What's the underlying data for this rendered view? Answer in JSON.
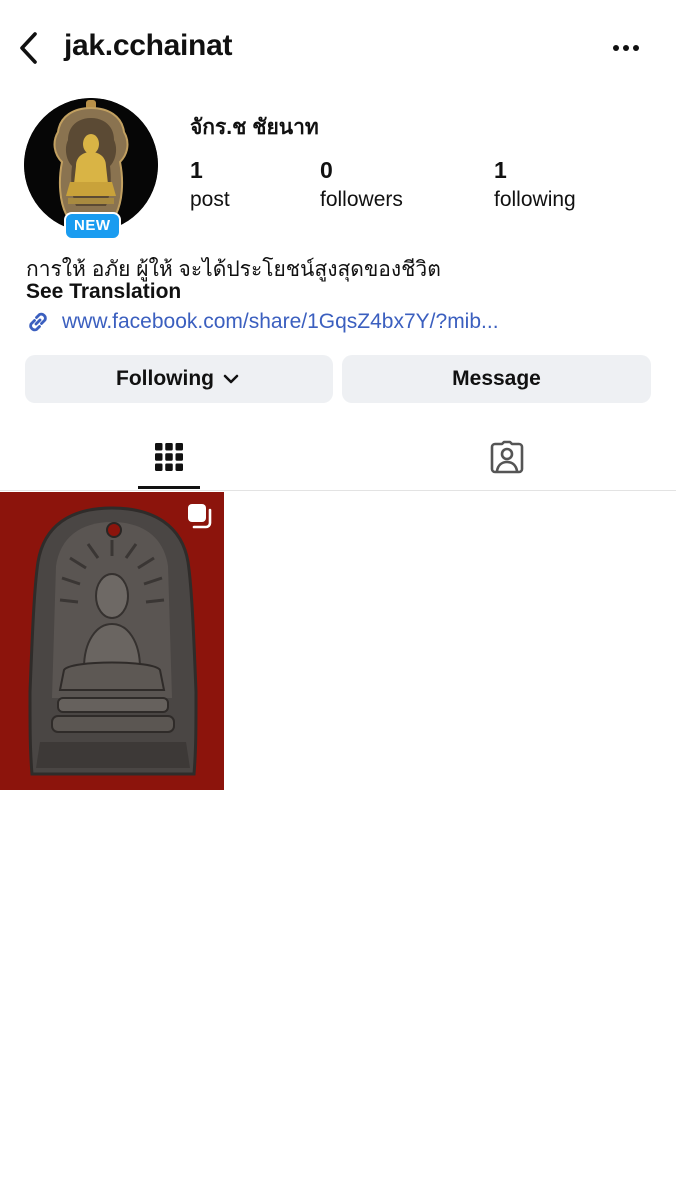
{
  "header": {
    "username": "jak.cchainat",
    "back_icon": "chevron-left-icon",
    "more_icon": "more-horizontal-icon"
  },
  "profile": {
    "display_name": "จักร.ช ชัยนาท",
    "new_badge": "NEW",
    "stats": [
      {
        "count": "1",
        "label": "post"
      },
      {
        "count": "0",
        "label": "followers"
      },
      {
        "count": "1",
        "label": "following"
      }
    ],
    "bio": "การให้ อภัย ผู้ให้ จะได้ประโยชน์สูงสุดของชีวิต",
    "see_translation": "See Translation",
    "link_text": "www.facebook.com/share/1GqsZ4bx7Y/?mib..."
  },
  "actions": {
    "following_label": "Following",
    "message_label": "Message"
  },
  "tabs": [
    {
      "icon": "grid-icon",
      "active": true
    },
    {
      "icon": "tagged-person-icon",
      "active": false
    }
  ],
  "posts": [
    {
      "icon": "multiple-photos-icon"
    }
  ],
  "colors": {
    "link": "#3b5fbf",
    "badge": "#1a9cf0",
    "button_bg": "#eef0f3",
    "post_bg": "#8c140c"
  }
}
